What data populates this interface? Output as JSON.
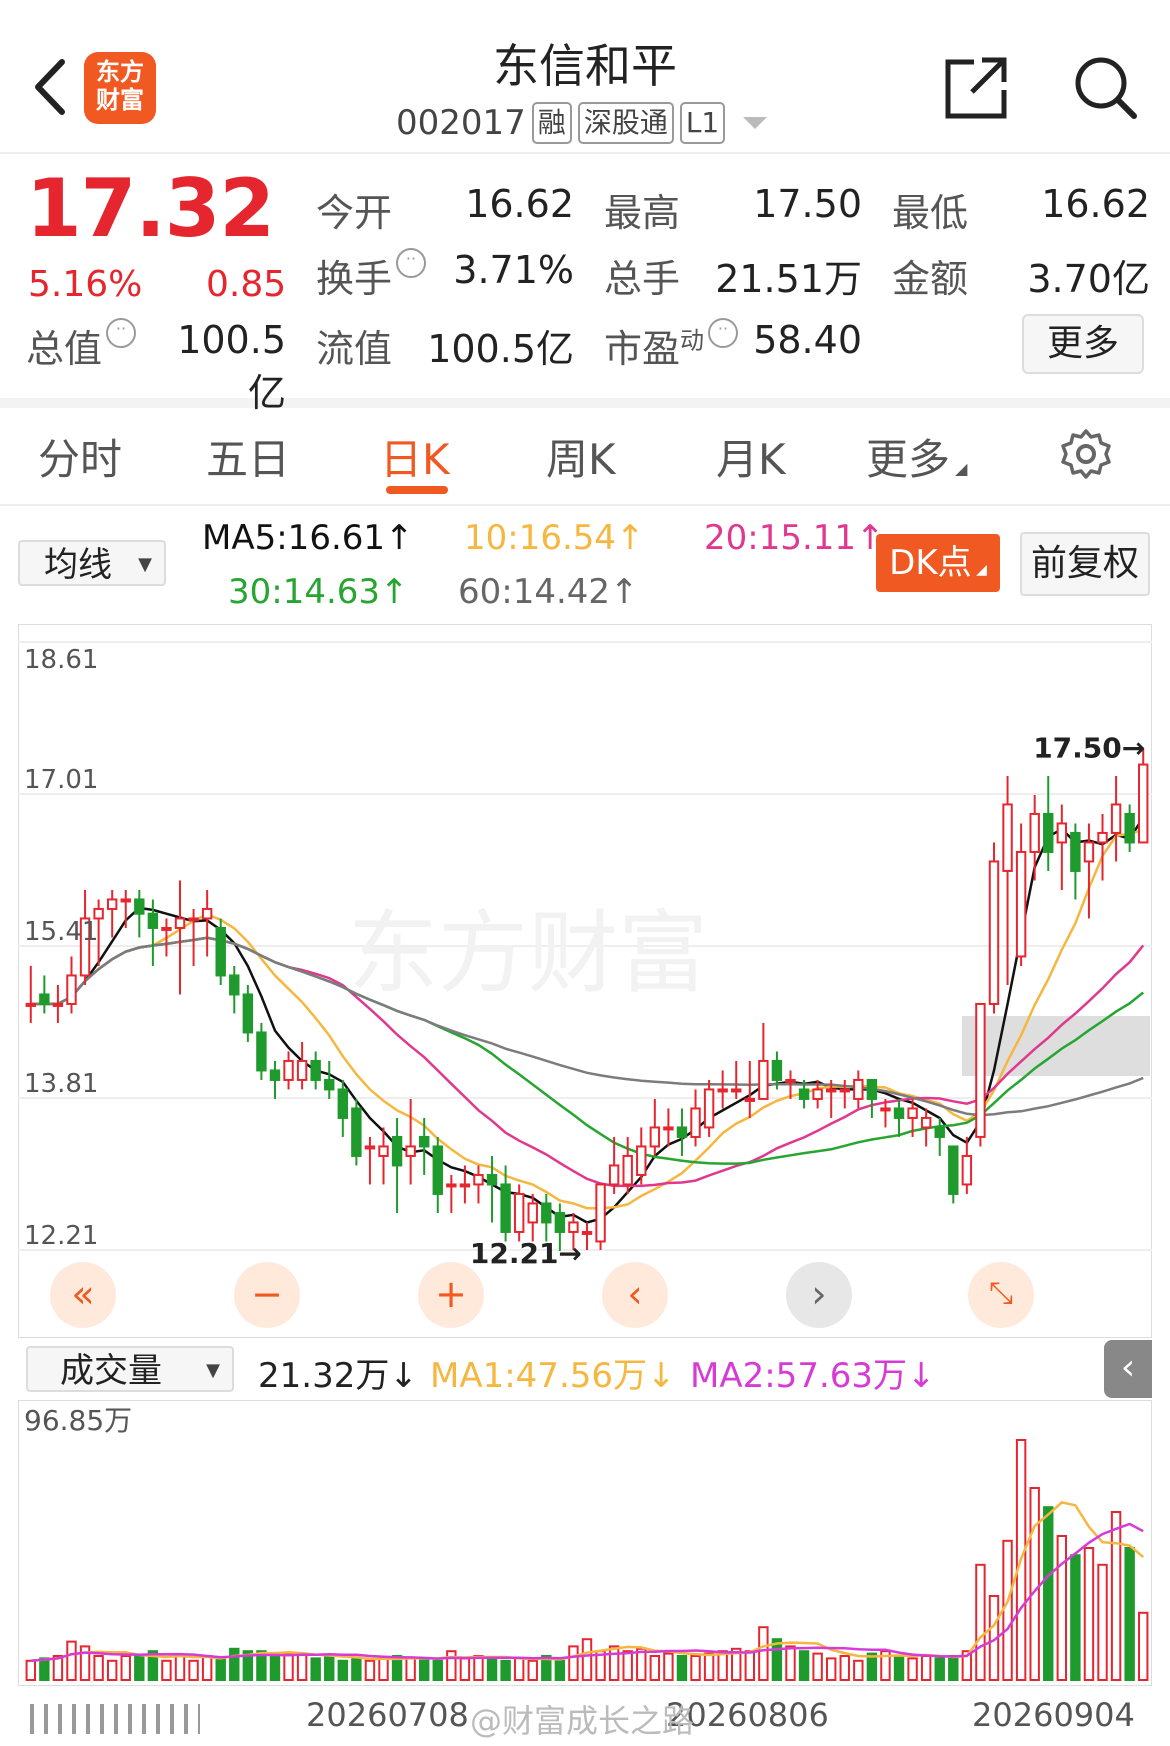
{
  "header": {
    "logo_text_line1": "东方",
    "logo_text_line2": "财富",
    "stock_name": "东信和平",
    "stock_code": "002017",
    "tags": [
      "融",
      "深股通",
      "L1"
    ]
  },
  "quote": {
    "price": "17.32",
    "change_pct": "5.16%",
    "change": "0.85",
    "fields": [
      {
        "label": "今开",
        "value": "16.62",
        "color": "red"
      },
      {
        "label": "最高",
        "value": "17.50",
        "color": "red"
      },
      {
        "label": "最低",
        "value": "16.62",
        "color": "red"
      },
      {
        "label": "换手",
        "value": "3.71%",
        "color": "black"
      },
      {
        "label": "总手",
        "value": "21.51万",
        "color": "black"
      },
      {
        "label": "金额",
        "value": "3.70亿",
        "color": "black"
      },
      {
        "label": "总值",
        "value": "100.5亿",
        "color": "black"
      },
      {
        "label": "流值",
        "value": "100.5亿",
        "color": "black"
      },
      {
        "label": "市盈",
        "label_sup": "动",
        "value": "58.40",
        "color": "black"
      }
    ],
    "more_label": "更多"
  },
  "tabs": [
    "分时",
    "五日",
    "日K",
    "周K",
    "月K",
    "更多"
  ],
  "active_tab": "日K",
  "ma_bar": {
    "select_label": "均线",
    "ma5": "MA5:16.61↑",
    "ma10": "10:16.54↑",
    "ma20": "20:15.11↑",
    "ma30": "30:14.63↑",
    "ma60": "60:14.42↑",
    "dk_label": "DK点",
    "adjust_label": "前复权"
  },
  "colors": {
    "up": "#e6262e",
    "down": "#1f9a2c",
    "ma5": "#111111",
    "ma10": "#f5b740",
    "ma20": "#e0388f",
    "ma30": "#27a531",
    "ma60": "#7c7c7c",
    "accent": "#f05a22"
  },
  "chart_data": {
    "type": "candlestick",
    "y_ticks": [
      "18.61",
      "17.01",
      "15.41",
      "13.81",
      "12.21"
    ],
    "ylim": [
      12.21,
      18.61
    ],
    "high_annotation": "17.50→",
    "low_annotation": "12.21→",
    "candles": [
      [
        14.8,
        14.8,
        15.2,
        14.6
      ],
      [
        14.9,
        14.8,
        15.1,
        14.7
      ],
      [
        14.8,
        14.8,
        15.0,
        14.6
      ],
      [
        14.8,
        15.1,
        15.3,
        14.7
      ],
      [
        15.1,
        15.7,
        16.0,
        15.0
      ],
      [
        15.7,
        15.8,
        15.9,
        15.2
      ],
      [
        15.8,
        15.9,
        16.0,
        15.5
      ],
      [
        15.9,
        15.9,
        16.0,
        15.6
      ],
      [
        15.9,
        15.75,
        16.0,
        15.5
      ],
      [
        15.75,
        15.6,
        15.9,
        15.2
      ],
      [
        15.6,
        15.6,
        15.7,
        15.3
      ],
      [
        15.6,
        15.7,
        16.1,
        14.9
      ],
      [
        15.7,
        15.7,
        15.8,
        15.2
      ],
      [
        15.7,
        15.8,
        16.0,
        15.3
      ],
      [
        15.6,
        15.1,
        15.7,
        15.0
      ],
      [
        15.1,
        14.9,
        15.2,
        14.7
      ],
      [
        14.9,
        14.5,
        15.0,
        14.4
      ],
      [
        14.5,
        14.1,
        14.6,
        14.0
      ],
      [
        14.1,
        14.0,
        14.2,
        13.8
      ],
      [
        14.0,
        14.2,
        14.3,
        13.9
      ],
      [
        14.0,
        14.2,
        14.4,
        13.9
      ],
      [
        14.2,
        14.0,
        14.3,
        13.9
      ],
      [
        14.0,
        13.9,
        14.2,
        13.8
      ],
      [
        13.9,
        13.6,
        14.0,
        13.4
      ],
      [
        13.7,
        13.2,
        13.8,
        13.1
      ],
      [
        13.3,
        13.3,
        13.4,
        12.9
      ],
      [
        13.2,
        13.3,
        13.5,
        12.9
      ],
      [
        13.4,
        13.1,
        13.6,
        12.6
      ],
      [
        13.2,
        13.3,
        13.8,
        12.9
      ],
      [
        13.4,
        13.3,
        13.6,
        13.0
      ],
      [
        13.3,
        12.8,
        13.4,
        12.6
      ],
      [
        12.9,
        12.9,
        13.0,
        12.6
      ],
      [
        12.9,
        12.9,
        13.1,
        12.7
      ],
      [
        12.9,
        13.0,
        13.1,
        12.7
      ],
      [
        13.0,
        12.9,
        13.2,
        12.5
      ],
      [
        12.9,
        12.4,
        13.1,
        12.3
      ],
      [
        12.4,
        12.8,
        12.9,
        12.3
      ],
      [
        12.5,
        12.7,
        12.8,
        12.3
      ],
      [
        12.7,
        12.5,
        12.8,
        12.3
      ],
      [
        12.6,
        12.4,
        12.7,
        12.2
      ],
      [
        12.4,
        12.5,
        12.6,
        12.21
      ],
      [
        12.4,
        12.4,
        12.5,
        12.21
      ],
      [
        12.3,
        12.9,
        12.9,
        12.21
      ],
      [
        12.9,
        13.1,
        13.4,
        12.8
      ],
      [
        12.9,
        13.2,
        13.4,
        12.8
      ],
      [
        13.0,
        13.3,
        13.5,
        12.9
      ],
      [
        13.3,
        13.5,
        13.8,
        13.2
      ],
      [
        13.5,
        13.5,
        13.7,
        13.3
      ],
      [
        13.5,
        13.4,
        13.7,
        13.2
      ],
      [
        13.4,
        13.7,
        13.9,
        13.3
      ],
      [
        13.5,
        13.9,
        14.0,
        13.4
      ],
      [
        13.9,
        13.9,
        14.1,
        13.7
      ],
      [
        13.9,
        13.9,
        14.2,
        13.8
      ],
      [
        13.8,
        13.8,
        14.2,
        13.6
      ],
      [
        13.8,
        14.2,
        14.6,
        13.8
      ],
      [
        14.2,
        14.0,
        14.3,
        13.9
      ],
      [
        14.0,
        14.0,
        14.1,
        13.8
      ],
      [
        13.9,
        13.8,
        14.0,
        13.7
      ],
      [
        13.8,
        13.9,
        14.0,
        13.7
      ],
      [
        13.9,
        13.9,
        14.0,
        13.6
      ],
      [
        13.9,
        13.9,
        14.0,
        13.7
      ],
      [
        13.8,
        14.0,
        14.1,
        13.7
      ],
      [
        14.0,
        13.8,
        14.0,
        13.6
      ],
      [
        13.7,
        13.7,
        13.8,
        13.5
      ],
      [
        13.7,
        13.6,
        13.8,
        13.4
      ],
      [
        13.6,
        13.7,
        13.8,
        13.4
      ],
      [
        13.5,
        13.6,
        13.7,
        13.3
      ],
      [
        13.5,
        13.4,
        13.6,
        13.2
      ],
      [
        13.3,
        12.8,
        13.3,
        12.7
      ],
      [
        12.9,
        13.2,
        13.4,
        12.8
      ],
      [
        13.4,
        14.8,
        14.8,
        13.3
      ],
      [
        14.8,
        16.3,
        16.5,
        14.7
      ],
      [
        16.2,
        16.9,
        17.2,
        15.0
      ],
      [
        15.3,
        16.4,
        16.7,
        15.2
      ],
      [
        16.4,
        16.8,
        17.0,
        16.1
      ],
      [
        16.8,
        16.4,
        17.2,
        16.2
      ],
      [
        16.5,
        16.7,
        16.9,
        16.0
      ],
      [
        16.6,
        16.2,
        16.7,
        15.9
      ],
      [
        16.3,
        16.5,
        16.7,
        15.7
      ],
      [
        16.5,
        16.6,
        16.8,
        16.1
      ],
      [
        16.6,
        16.9,
        17.2,
        16.3
      ],
      [
        16.8,
        16.5,
        16.9,
        16.4
      ],
      [
        16.5,
        17.32,
        17.5,
        16.5
      ]
    ],
    "volume_label": "21.32万↓",
    "volume_ma1": "MA1:47.56万↓",
    "volume_ma2": "MA2:57.63万↓",
    "volume_max_label": "96.85万",
    "volumes": [
      8,
      9,
      10,
      16,
      14,
      10,
      8,
      10,
      10,
      12,
      8,
      10,
      8,
      10,
      9,
      13,
      12,
      12,
      10,
      11,
      11,
      9,
      10,
      8,
      9,
      8,
      9,
      10,
      9,
      9,
      8,
      12,
      9,
      10,
      9,
      8,
      9,
      8,
      10,
      8,
      14,
      17,
      12,
      14,
      12,
      13,
      10,
      11,
      10,
      10,
      11,
      12,
      13,
      12,
      22,
      17,
      14,
      12,
      11,
      9,
      10,
      8,
      11,
      12,
      10,
      9,
      10,
      9,
      10,
      12,
      48,
      35,
      58,
      100,
      80,
      72,
      60,
      52,
      55,
      48,
      70,
      55,
      28
    ]
  },
  "x_axis_labels": [
    "20260708",
    "20260806",
    "20260904"
  ],
  "watermark": "东方财富",
  "weibo_watermark": "@财富成长之路"
}
